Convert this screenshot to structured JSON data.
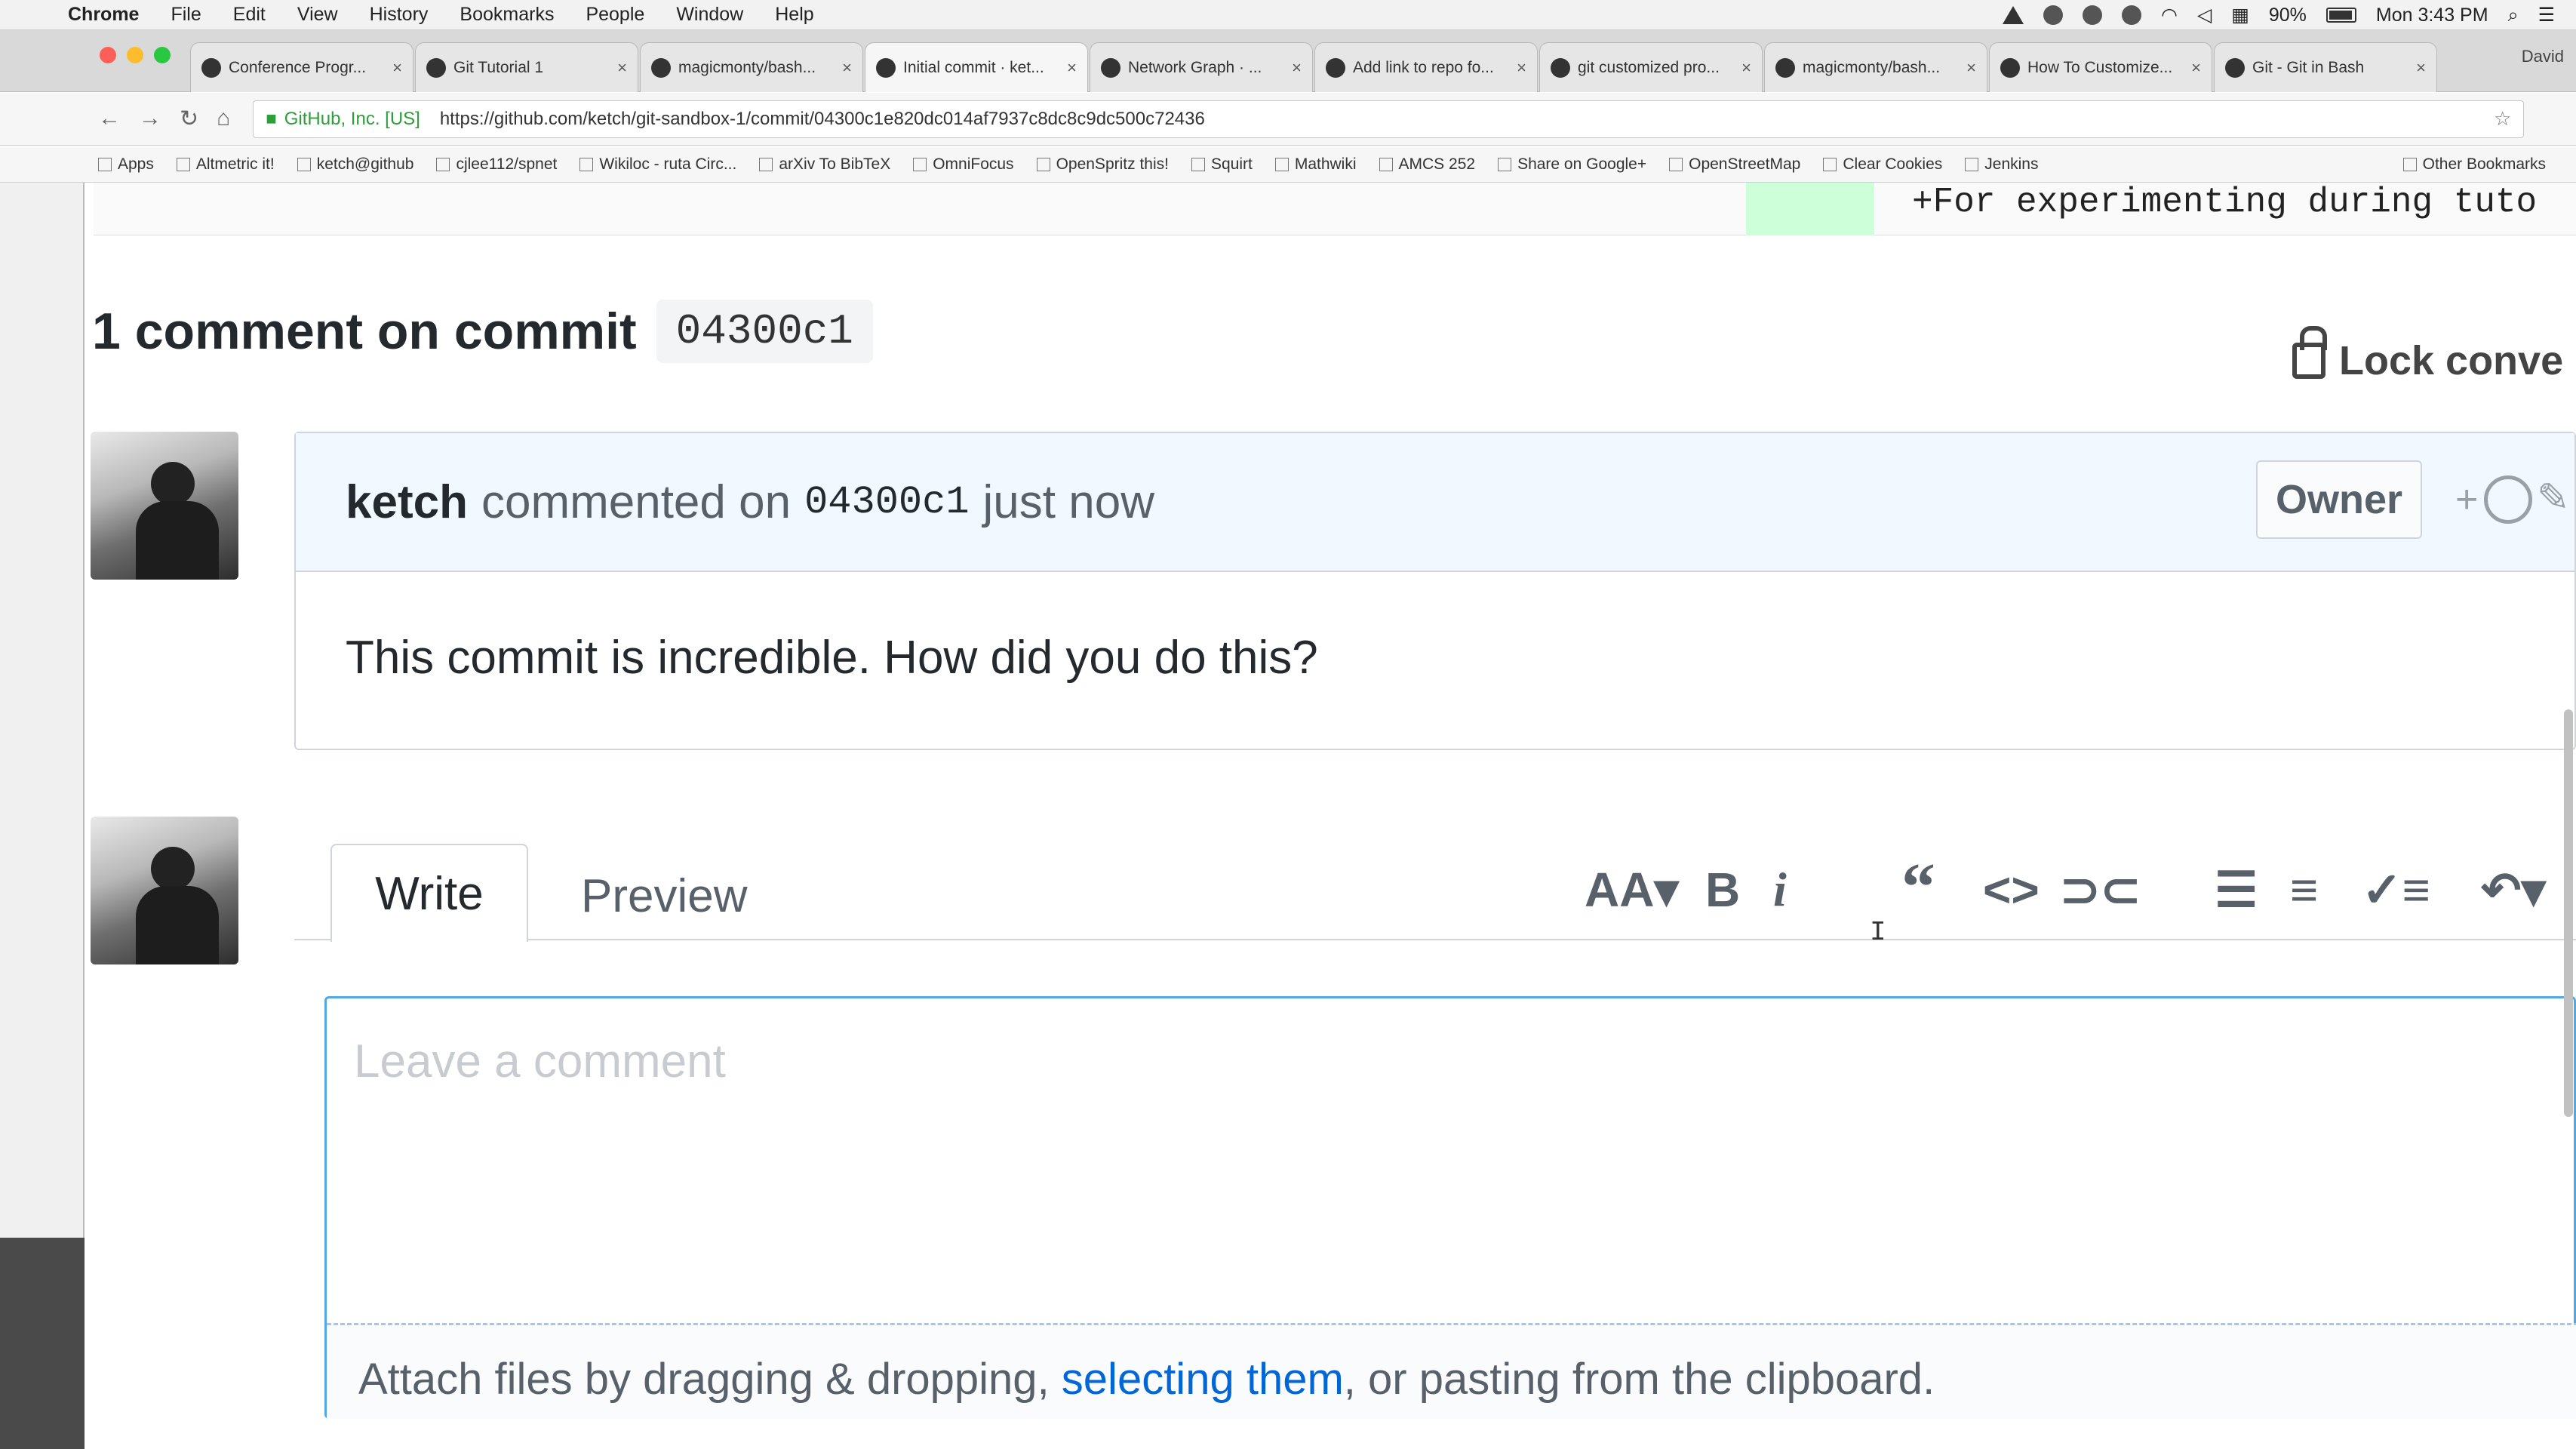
{
  "menubar": {
    "app": "Chrome",
    "items": [
      "File",
      "Edit",
      "View",
      "History",
      "Bookmarks",
      "People",
      "Window",
      "Help"
    ],
    "battery": "90%",
    "clock": "Mon 3:43 PM"
  },
  "tabs": [
    {
      "title": "Conference Progr..."
    },
    {
      "title": "Git Tutorial 1"
    },
    {
      "title": "magicmonty/bash..."
    },
    {
      "title": "Initial commit · ket..."
    },
    {
      "title": "Network Graph · ..."
    },
    {
      "title": "Add link to repo fo..."
    },
    {
      "title": "git customized pro..."
    },
    {
      "title": "magicmonty/bash..."
    },
    {
      "title": "How To Customize..."
    },
    {
      "title": "Git - Git in Bash"
    }
  ],
  "profile": "David",
  "omnibox": {
    "org": "GitHub, Inc. [US]",
    "url": "https://github.com/ketch/git-sandbox-1/commit/04300c1e820dc014af7937c8dc8c9dc500c72436"
  },
  "bookmarks": [
    "Apps",
    "Altmetric it!",
    "ketch@github",
    "cjlee112/spnet",
    "Wikiloc - ruta Circ...",
    "arXiv To BibTeX",
    "OmniFocus",
    "OpenSpritz this!",
    "Squirt",
    "Mathwiki",
    "AMCS 252",
    "Share on Google+",
    "OpenStreetMap",
    "Clear Cookies",
    "Jenkins"
  ],
  "bookmarks_other": "Other Bookmarks",
  "diff": {
    "line": "+For experimenting during tuto"
  },
  "heading": {
    "text": "1 comment on commit",
    "sha": "04300c1"
  },
  "lock_label": "Lock conve",
  "comment": {
    "author": "ketch",
    "action": "commented on",
    "sha": "04300c1",
    "time": "just now",
    "badge": "Owner",
    "body": "This commit is incredible. How did you do this?"
  },
  "editor": {
    "tab_write": "Write",
    "tab_preview": "Preview",
    "placeholder": "Leave a comment",
    "attach_pre": "Attach files by dragging & dropping, ",
    "attach_link": "selecting them",
    "attach_post": ", or pasting from the clipboard.",
    "tools": {
      "heading": "AA▾",
      "bold": "B",
      "italic": "i",
      "quote": "“",
      "code": "<>",
      "link": "⊃⊂",
      "ul": "☰",
      "ol": "≡",
      "tasks": "✓≡",
      "reply": "↶▾"
    }
  }
}
